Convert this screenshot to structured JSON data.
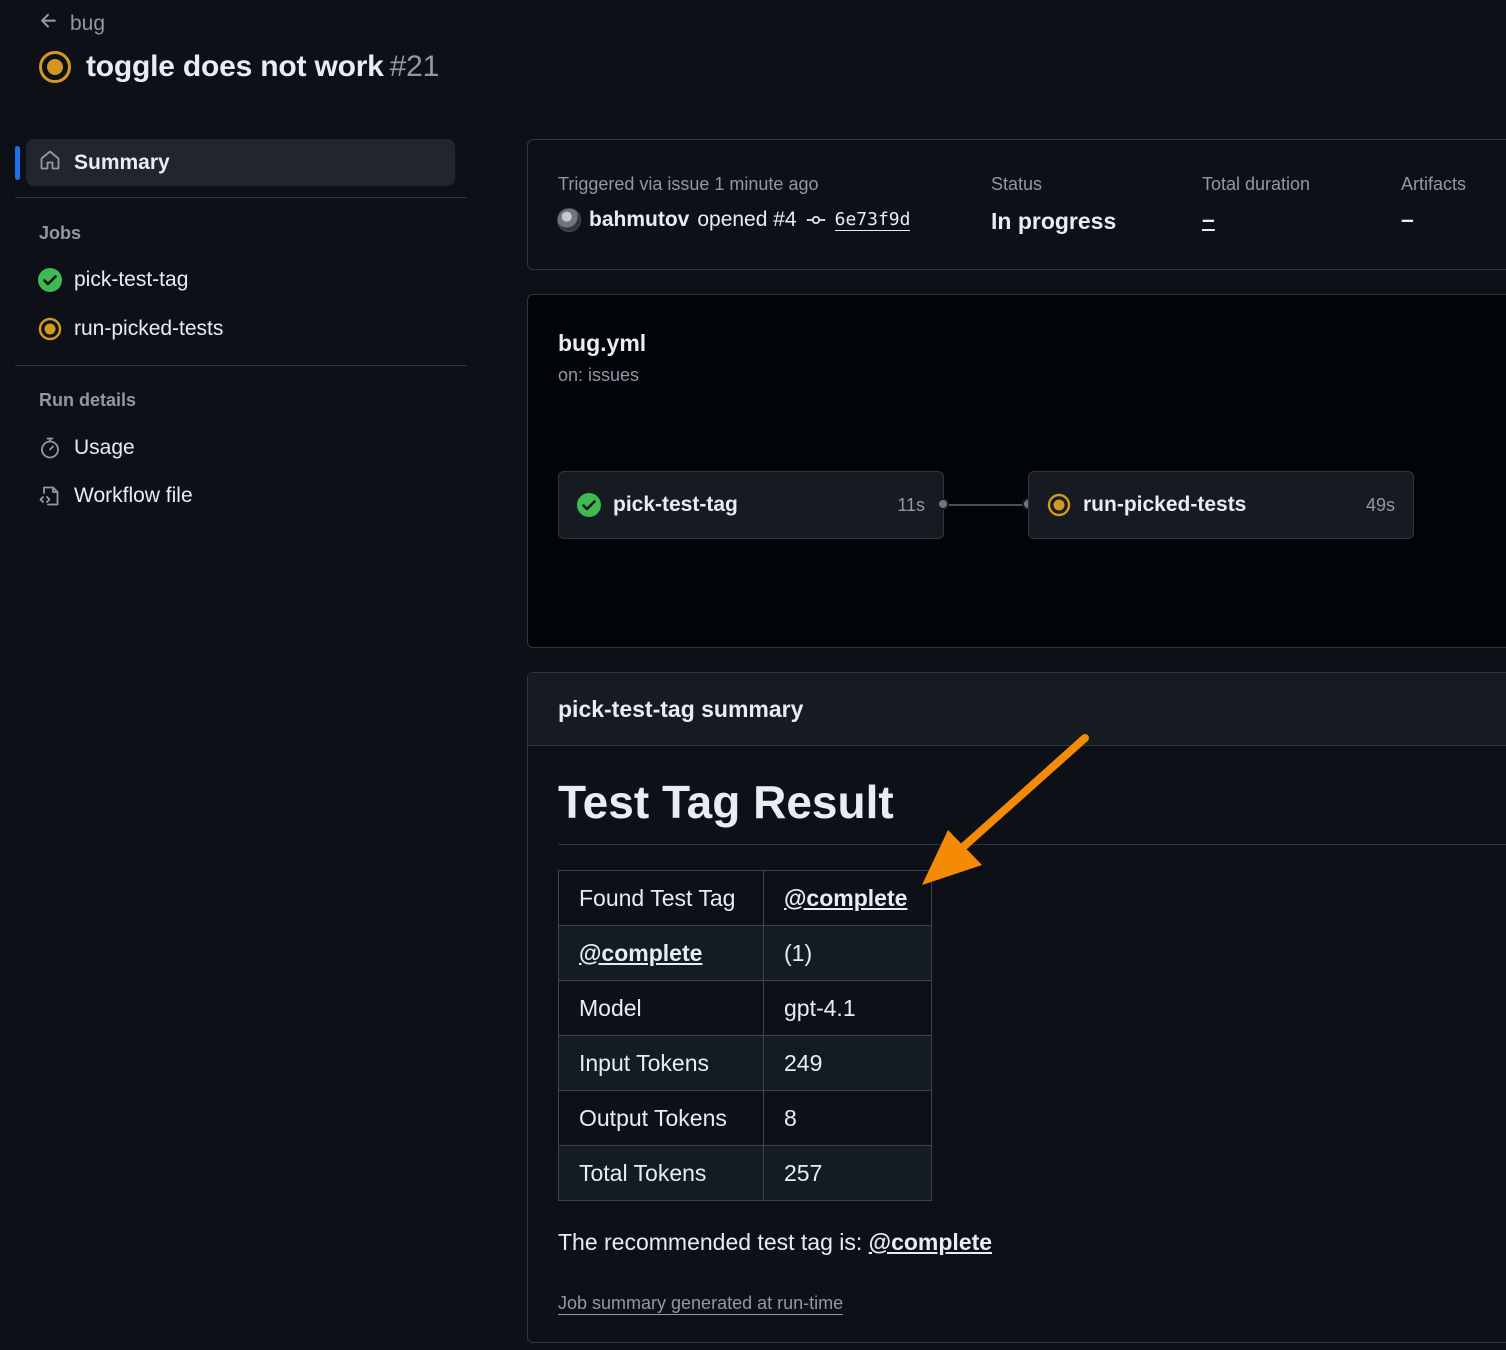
{
  "header": {
    "back_label": "bug",
    "title": "toggle does not work",
    "run_number": "#21"
  },
  "sidebar": {
    "summary_label": "Summary",
    "jobs_label": "Jobs",
    "jobs": [
      {
        "label": "pick-test-tag",
        "status": "success"
      },
      {
        "label": "run-picked-tests",
        "status": "in_progress"
      }
    ],
    "run_details_label": "Run details",
    "usage_label": "Usage",
    "workflow_file_label": "Workflow file"
  },
  "run_info": {
    "triggered_text": "Triggered via issue 1 minute ago",
    "user": "bahmutov",
    "action": "opened #4",
    "commit": "6e73f9d",
    "status_label": "Status",
    "status_value": "In progress",
    "duration_label": "Total duration",
    "duration_value": "–",
    "artifacts_label": "Artifacts",
    "artifacts_value": "–"
  },
  "workflow": {
    "name": "bug.yml",
    "trigger": "on: issues",
    "jobs": [
      {
        "label": "pick-test-tag",
        "duration": "11s",
        "status": "success"
      },
      {
        "label": "run-picked-tests",
        "duration": "49s",
        "status": "in_progress"
      }
    ]
  },
  "summary": {
    "title": "pick-test-tag summary",
    "heading": "Test Tag Result",
    "table": [
      [
        "Found Test Tag",
        "@complete"
      ],
      [
        "@complete",
        "(1)"
      ],
      [
        "Model",
        "gpt-4.1"
      ],
      [
        "Input Tokens",
        "249"
      ],
      [
        "Output Tokens",
        "8"
      ],
      [
        "Total Tokens",
        "257"
      ]
    ],
    "recommend_prefix": "The recommended test tag is: ",
    "recommend_tag": "@complete",
    "generated_note": "Job summary generated at run-time"
  },
  "colors": {
    "background": "#0d1117",
    "success": "#3fb950",
    "in_progress": "#d29922",
    "accent": "#1f6feb",
    "annotation_arrow": "#f58a07"
  }
}
